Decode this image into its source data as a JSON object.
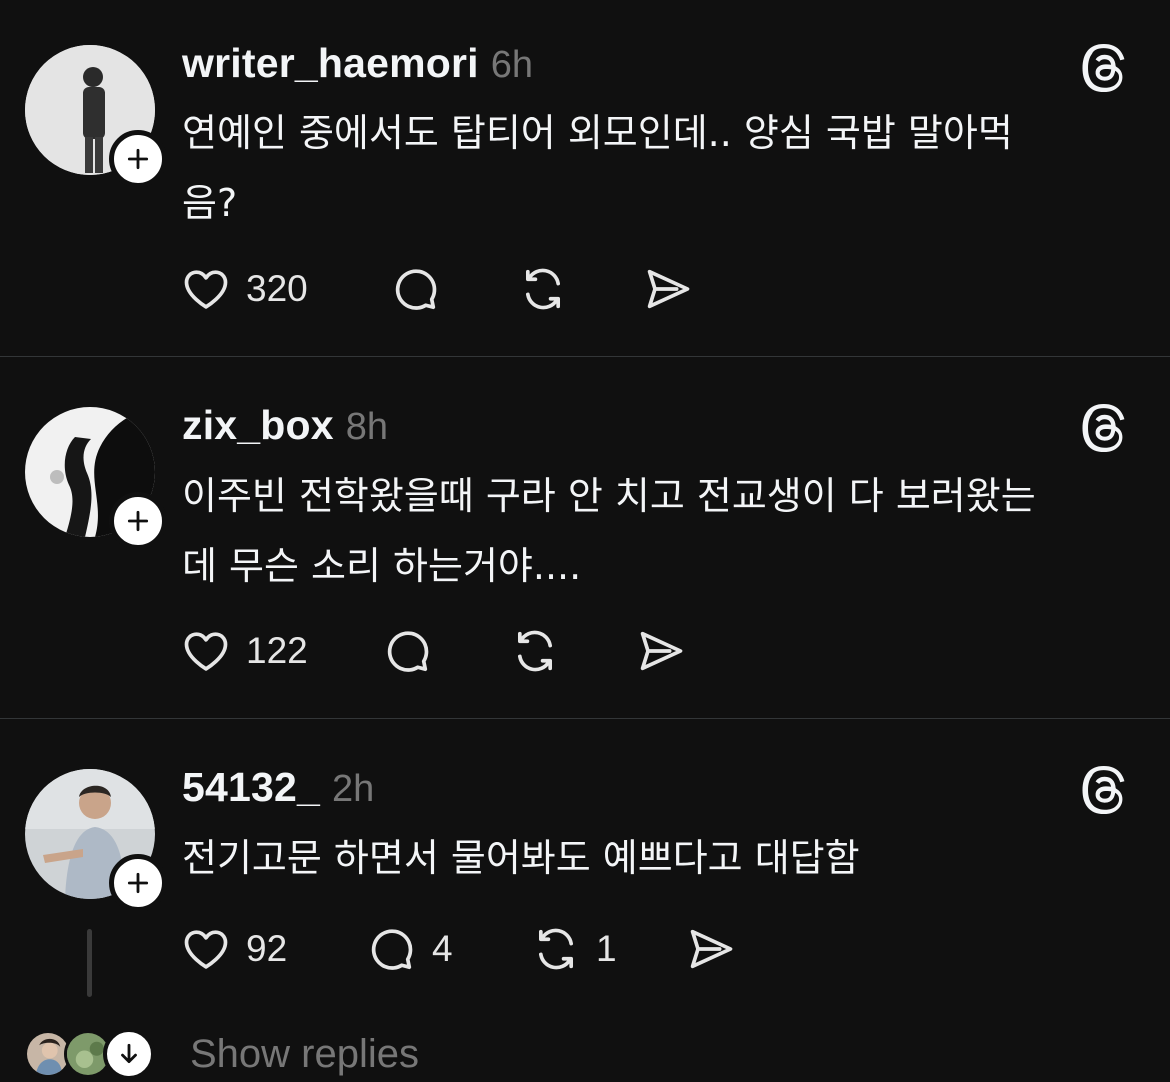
{
  "colors": {
    "background": "#101010",
    "text": "#f3f5f7",
    "muted": "#777777",
    "divider": "#333638"
  },
  "posts": [
    {
      "username": "writer_haemori",
      "time": "6h",
      "text": "연예인 중에서도 탑티어 외모인데.. 양심 국밥 말아먹\n음?",
      "likes": "320",
      "replies": "",
      "reposts": ""
    },
    {
      "username": "zix_box",
      "time": "8h",
      "text": "이주빈 전학왔을때 구라 안 치고 전교생이 다 보러왔는\n데 무슨 소리 하는거야....",
      "likes": "122",
      "replies": "",
      "reposts": ""
    },
    {
      "username": "54132_",
      "time": "2h",
      "text": "전기고문 하면서 물어봐도 예쁘다고 대답함",
      "likes": "92",
      "replies": "4",
      "reposts": "1"
    }
  ],
  "thread_footer": {
    "show_replies_label": "Show replies"
  },
  "icons": {
    "like": "heart-icon",
    "reply": "comment-icon",
    "repost": "repost-icon",
    "share": "send-icon",
    "follow": "plus-icon",
    "threads": "threads-logo-icon",
    "expand": "arrow-down-icon"
  }
}
